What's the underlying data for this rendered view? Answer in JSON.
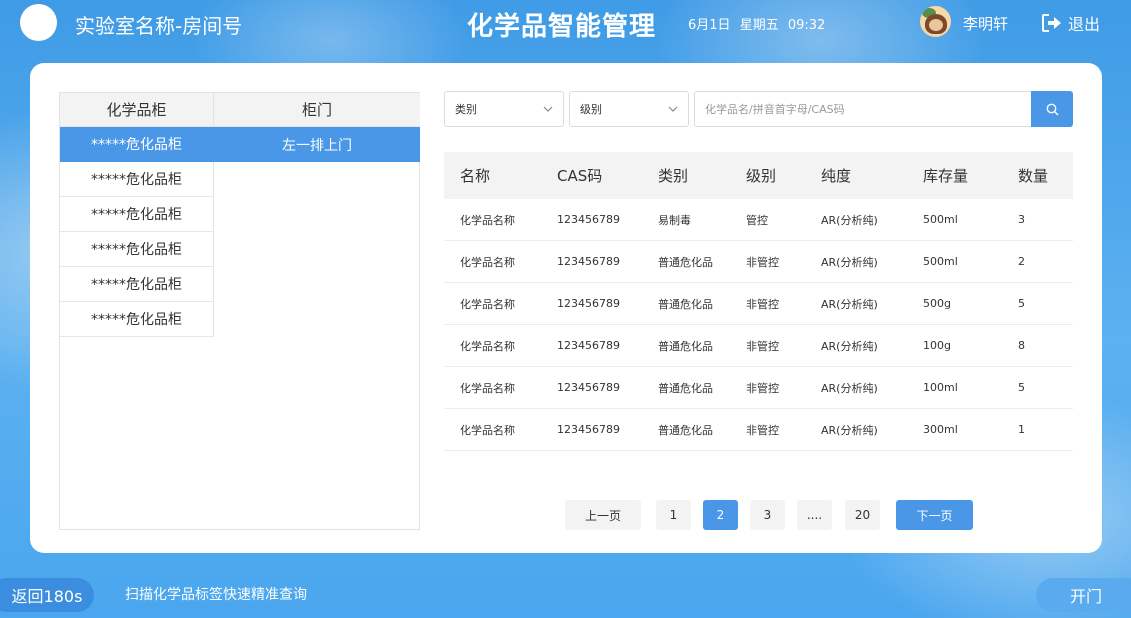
{
  "header": {
    "lab_name": "实验室名称-房间号",
    "app_title": "化学品智能管理",
    "date": "6月1日",
    "weekday": "星期五",
    "time": "09:32",
    "user_name": "李明轩",
    "logout_label": "退出"
  },
  "cabinet_table": {
    "col_cabinet": "化学品柜",
    "col_door": "柜门",
    "cabinets": [
      {
        "label": "*****危化品柜",
        "active": true
      },
      {
        "label": "*****危化品柜",
        "active": false
      },
      {
        "label": "*****危化品柜",
        "active": false
      },
      {
        "label": "*****危化品柜",
        "active": false
      },
      {
        "label": "*****危化品柜",
        "active": false
      },
      {
        "label": "*****危化品柜",
        "active": false
      }
    ],
    "doors": [
      "左一排上门"
    ]
  },
  "filters": {
    "category_placeholder": "类别",
    "level_placeholder": "级别",
    "search_placeholder": "化学品名/拼音首字母/CAS码"
  },
  "chem_table": {
    "headers": [
      "名称",
      "CAS码",
      "类别",
      "级别",
      "纯度",
      "库存量",
      "数量"
    ],
    "rows": [
      [
        "化学品名称",
        "123456789",
        "易制毒",
        "管控",
        "AR(分析纯)",
        "500ml",
        "3"
      ],
      [
        "化学品名称",
        "123456789",
        "普通危化品",
        "非管控",
        "AR(分析纯)",
        "500ml",
        "2"
      ],
      [
        "化学品名称",
        "123456789",
        "普通危化品",
        "非管控",
        "AR(分析纯)",
        "500g",
        "5"
      ],
      [
        "化学品名称",
        "123456789",
        "普通危化品",
        "非管控",
        "AR(分析纯)",
        "100g",
        "8"
      ],
      [
        "化学品名称",
        "123456789",
        "普通危化品",
        "非管控",
        "AR(分析纯)",
        "100ml",
        "5"
      ],
      [
        "化学品名称",
        "123456789",
        "普通危化品",
        "非管控",
        "AR(分析纯)",
        "300ml",
        "1"
      ]
    ]
  },
  "pagination": {
    "prev_label": "上一页",
    "pages": [
      "1",
      "2",
      "3",
      "....",
      "20"
    ],
    "current_page": "2",
    "next_label": "下一页"
  },
  "footer": {
    "back_label": "返回180s",
    "scan_tip": "扫描化学品标签快速精准查询",
    "open_label": "开门"
  },
  "colors": {
    "accent": "#4a97e8",
    "background": "#4aa6ee"
  }
}
